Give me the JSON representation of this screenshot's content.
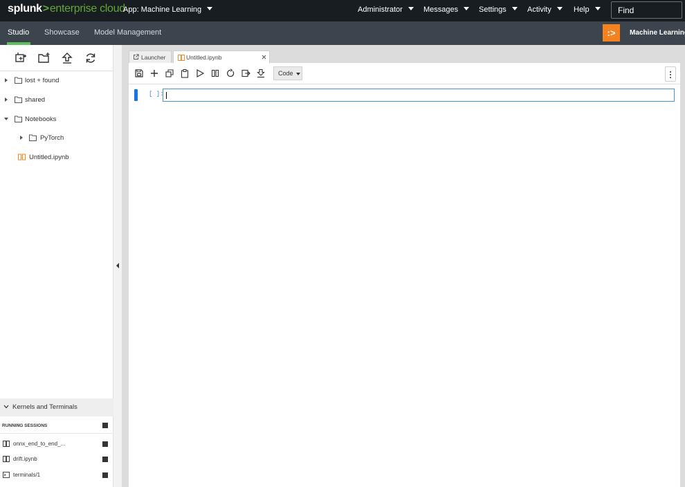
{
  "topbar": {
    "brand": {
      "part1": "splunk",
      "sep": ">",
      "part2": "enterprise cloud"
    },
    "app_menu": "App: Machine Learning",
    "nav": [
      "Administrator",
      "Messages",
      "Settings",
      "Activity",
      "Help"
    ],
    "search": {
      "placeholder": "Find"
    }
  },
  "appbar": {
    "tabs": [
      "Studio",
      "Showcase",
      "Model Management"
    ],
    "active_tab": "Studio",
    "logo_glyph": ":>",
    "app_title": "Machine Learning",
    "accent_color": "#f58220",
    "active_underline_color": "#5cc05c"
  },
  "file_browser": {
    "toolbar_icons": [
      "new-launcher-icon",
      "new-folder-icon",
      "upload-icon",
      "refresh-icon"
    ],
    "items": [
      {
        "label": "lost + found",
        "type": "folder",
        "expanded": false
      },
      {
        "label": "shared",
        "type": "folder",
        "expanded": false
      },
      {
        "label": "Notebooks",
        "type": "folder",
        "expanded": true
      },
      {
        "label": "PyTorch",
        "type": "folder",
        "expanded": false
      },
      {
        "label": "Untitled.ipynb",
        "type": "notebook"
      }
    ]
  },
  "kernels": {
    "header": "Kernels and Terminals",
    "section_title": "RUNNING SESSIONS",
    "sessions": [
      {
        "label": "onnx_end_to_end_...",
        "type": "notebook"
      },
      {
        "label": "drift.ipynb",
        "type": "notebook"
      },
      {
        "label": "terminals/1",
        "type": "terminal"
      }
    ]
  },
  "main": {
    "tabs": [
      {
        "label": "Launcher",
        "icon": "launcher-icon"
      },
      {
        "label": "Untitled.ipynb",
        "icon": "notebook-icon",
        "active": true,
        "closable": true
      }
    ],
    "toolbar": {
      "buttons": [
        "save-icon",
        "add-cell-icon",
        "cut-icon",
        "copy-icon",
        "run-icon",
        "interrupt-icon",
        "restart-icon",
        "restart-run-all-icon",
        "download-icon"
      ],
      "cell_type": "Code"
    },
    "cell": {
      "prompt": "[ ]:",
      "content": ""
    }
  }
}
